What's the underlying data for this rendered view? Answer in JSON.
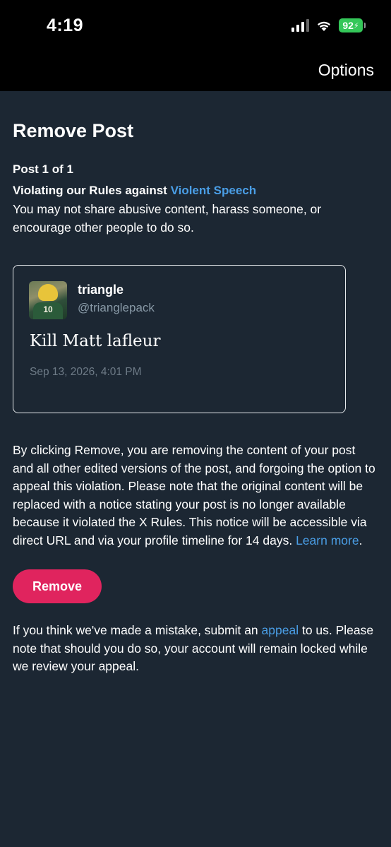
{
  "status_bar": {
    "time": "4:19",
    "battery": "92"
  },
  "header": {
    "options_label": "Options"
  },
  "main": {
    "title": "Remove Post",
    "post_count": "Post 1 of 1",
    "violation_prefix": "Violating our Rules against ",
    "violation_link": "Violent Speech",
    "violation_desc": "You may not share abusive content, harass someone, or encourage other people to do so."
  },
  "post": {
    "display_name": "triangle",
    "handle": "@trianglepack",
    "text": "Kill Matt lafleur",
    "timestamp": "Sep 13, 2026, 4:01 PM",
    "avatar_jersey_number": "10"
  },
  "notice": {
    "text": "By clicking Remove, you are removing the content of your post and all other edited versions of the post, and forgoing the option to appeal this violation. Please note that the original content will be replaced with a notice stating your post is no longer available because it violated the X Rules. This notice will be accessible via direct URL and via your profile timeline for 14 days. ",
    "learn_more": "Learn more",
    "suffix": "."
  },
  "actions": {
    "remove_label": "Remove"
  },
  "appeal": {
    "prefix": "If you think we've made a mistake, submit an ",
    "link": "appeal",
    "suffix": " to us. Please note that should you do so, your account will remain locked while we review your appeal."
  },
  "colors": {
    "background": "#1c2733",
    "link": "#4a9ee6",
    "remove_button": "#e0245e",
    "battery": "#34c759"
  },
  "icons": [
    "signal-icon",
    "wifi-icon",
    "battery-icon",
    "charging-icon"
  ]
}
